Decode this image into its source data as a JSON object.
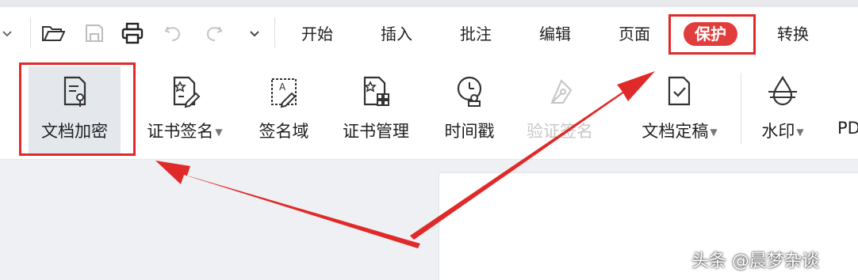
{
  "quick_access": {
    "items": [
      "chevron-down-icon",
      "open-folder-icon",
      "save-icon",
      "print-icon",
      "undo-icon",
      "redo-icon",
      "more-dropdown-icon"
    ]
  },
  "tabs": [
    {
      "label": "开始"
    },
    {
      "label": "插入"
    },
    {
      "label": "批注"
    },
    {
      "label": "编辑"
    },
    {
      "label": "页面"
    },
    {
      "label": "保护",
      "active": true
    },
    {
      "label": "转换"
    }
  ],
  "ribbon": {
    "tools": [
      {
        "label": "文档加密",
        "icon": "document-encrypt-icon",
        "selected": true
      },
      {
        "label": "证书签名",
        "icon": "certificate-sign-icon",
        "dropdown": true
      },
      {
        "label": "签名域",
        "icon": "signature-field-icon"
      },
      {
        "label": "证书管理",
        "icon": "certificate-manage-icon"
      },
      {
        "label": "时间戳",
        "icon": "timestamp-icon"
      },
      {
        "label": "验证签名",
        "icon": "verify-signature-icon",
        "disabled": true
      },
      {
        "label": "文档定稿",
        "icon": "document-finalize-icon",
        "dropdown": true
      },
      {
        "label": "水印",
        "icon": "watermark-icon",
        "dropdown": true
      },
      {
        "label": "PD",
        "icon": ""
      }
    ]
  },
  "annotation_color": "#e02a2a",
  "active_tab_color": "#e23d3d",
  "watermark_text": "头条 @晨梦杂谈"
}
